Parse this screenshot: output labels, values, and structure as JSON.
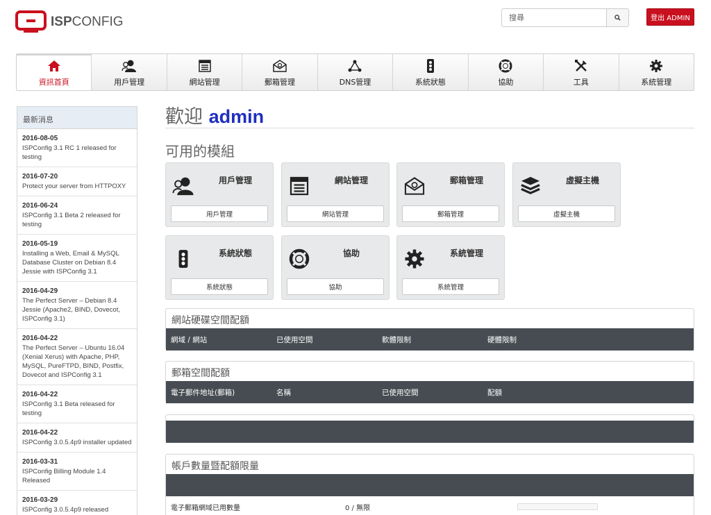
{
  "header": {
    "logo_text_bold": "ISP",
    "logo_text_rest": "CONFIG",
    "search_placeholder": "搜尋",
    "logout_label": "登出 ADMIN"
  },
  "mainnav": {
    "items": [
      {
        "label": "資訊首頁",
        "icon": "home-icon"
      },
      {
        "label": "用戶管理",
        "icon": "users-icon"
      },
      {
        "label": "網站管理",
        "icon": "website-icon"
      },
      {
        "label": "郵箱管理",
        "icon": "mail-icon"
      },
      {
        "label": "DNS管理",
        "icon": "dns-icon"
      },
      {
        "label": "系統狀態",
        "icon": "traffic-light-icon"
      },
      {
        "label": "協助",
        "icon": "lifebuoy-icon"
      },
      {
        "label": "工具",
        "icon": "tools-icon"
      },
      {
        "label": "系統管理",
        "icon": "gear-icon"
      }
    ],
    "active_color": "#c9101f"
  },
  "sidebar": {
    "heading": "最新消息",
    "news": [
      {
        "date": "2016-08-05",
        "text": "ISPConfig 3.1 RC 1 released for testing"
      },
      {
        "date": "2016-07-20",
        "text": "Protect your server from HTTPOXY"
      },
      {
        "date": "2016-06-24",
        "text": "ISPConfig 3.1 Beta 2 released for testing"
      },
      {
        "date": "2016-05-19",
        "text": "Installing a Web, Email & MySQL Database Cluster on Debian 8.4 Jessie with ISPConfig 3.1"
      },
      {
        "date": "2016-04-29",
        "text": "The Perfect Server – Debian 8.4 Jessie (Apache2, BIND, Dovecot, ISPConfig 3.1)"
      },
      {
        "date": "2016-04-22",
        "text": "The Perfect Server – Ubuntu 16.04 (Xenial Xerus) with Apache, PHP, MySQL, PureFTPD, BIND, Postfix, Dovecot and ISPConfig 3.1"
      },
      {
        "date": "2016-04-22",
        "text": "ISPConfig 3.1 Beta released for testing"
      },
      {
        "date": "2016-04-22",
        "text": "ISPConfig 3.0.5.4p9 installer updated"
      },
      {
        "date": "2016-03-31",
        "text": "ISPConfig Billing Module 1.4 Released"
      },
      {
        "date": "2016-03-29",
        "text": "ISPConfig 3.0.5.4p9 released"
      }
    ]
  },
  "main": {
    "welcome_prefix": "歡迎",
    "welcome_user": "admin",
    "modules_title": "可用的模組",
    "modules": [
      {
        "title": "用戶管理",
        "button": "用戶管理",
        "icon": "users-icon"
      },
      {
        "title": "網站管理",
        "button": "網站管理",
        "icon": "website-icon"
      },
      {
        "title": "郵箱管理",
        "button": "郵箱管理",
        "icon": "mail-icon"
      },
      {
        "title": "虛擬主機",
        "button": "虛擬主機",
        "icon": "server-stack-icon"
      },
      {
        "title": "系統狀態",
        "button": "系統狀態",
        "icon": "traffic-light-icon"
      },
      {
        "title": "協助",
        "button": "協助",
        "icon": "lifebuoy-icon"
      },
      {
        "title": "系統管理",
        "button": "系統管理",
        "icon": "gear-icon"
      }
    ],
    "web_quota": {
      "title": "網站硬碟空間配額",
      "columns": [
        "網域 / 網站",
        "已使用空間",
        "軟體限制",
        "硬體限制"
      ]
    },
    "mail_quota": {
      "title": "郵箱空間配額",
      "columns": [
        "電子郵件地址(郵箱)",
        "名稱",
        "已使用空間",
        "配額"
      ]
    },
    "limits": {
      "title": "帳戶數量暨配額限量",
      "rows": [
        {
          "label": "電子郵箱網域已用數量",
          "value": "0 / 無限"
        }
      ]
    }
  }
}
